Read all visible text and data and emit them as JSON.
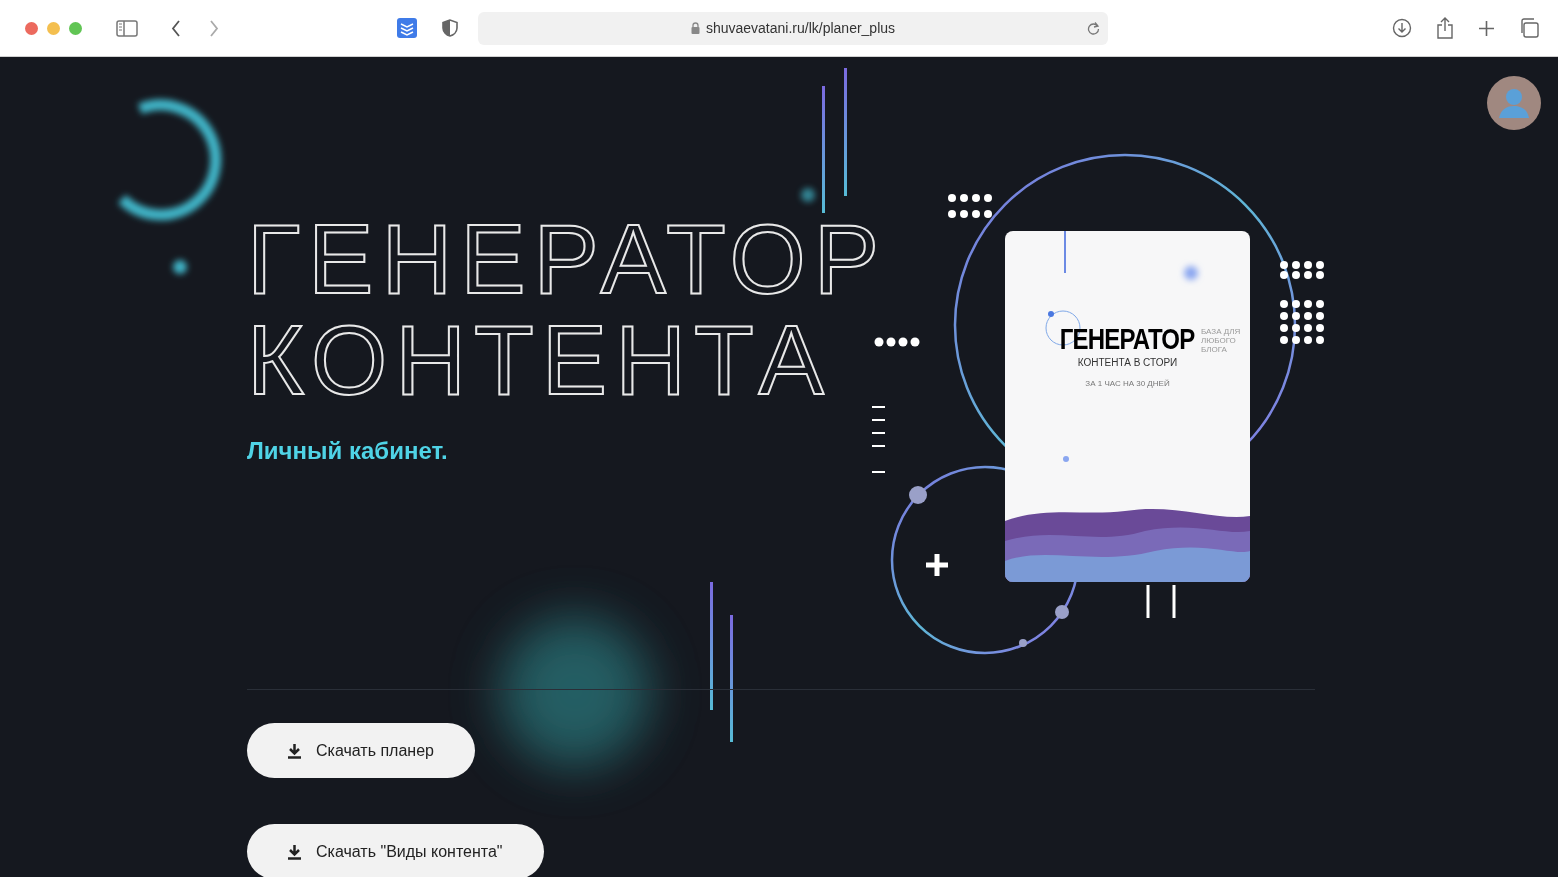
{
  "browser": {
    "url": "shuvaevatani.ru/lk/planer_plus"
  },
  "hero": {
    "title_lines": [
      "ГЕНЕРАТОР",
      "КОНТЕНТА"
    ],
    "subtitle": "Личный кабинет."
  },
  "cover": {
    "title": "ГЕНЕРАТОР",
    "subtitle": "КОНТЕНТА В СТОРИ",
    "tagline": "ЗА 1 ЧАС НА 30 ДНЕЙ",
    "side_note": "БАЗА ДЛЯ ЛЮБОГО БЛОГА"
  },
  "buttons": [
    {
      "label": "Скачать планер"
    },
    {
      "label": "Скачать \"Виды контента\""
    }
  ]
}
